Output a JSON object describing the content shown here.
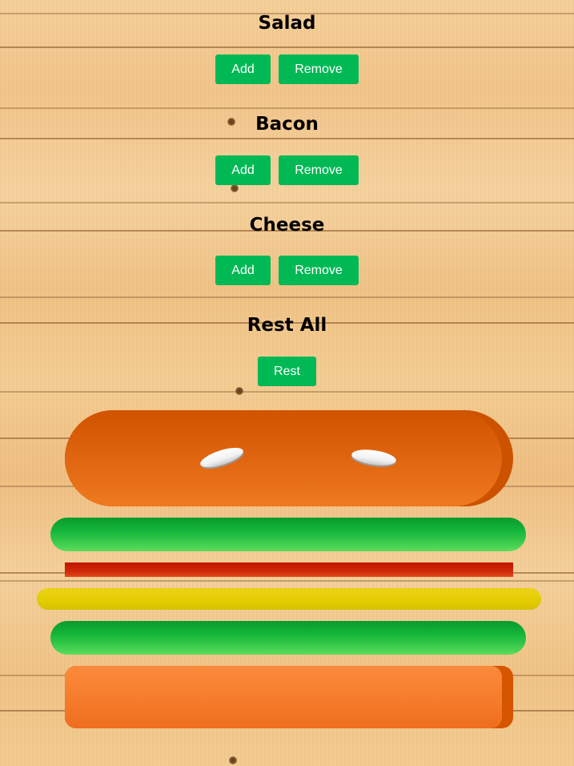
{
  "controls": [
    {
      "title": "Salad",
      "add_label": "Add",
      "remove_label": "Remove"
    },
    {
      "title": "Bacon",
      "add_label": "Add",
      "remove_label": "Remove"
    },
    {
      "title": "Cheese",
      "add_label": "Add",
      "remove_label": "Remove"
    }
  ],
  "reset": {
    "title": "Rest All",
    "button_label": "Rest"
  },
  "burger": {
    "layers": [
      "bun-top",
      "salad",
      "bacon",
      "cheese",
      "salad",
      "bun-bottom"
    ]
  },
  "colors": {
    "button": "#00b955",
    "button_text": "#ffffff",
    "bun": "#e06511",
    "salad": "#14b63a",
    "bacon": "#c21400",
    "cheese": "#e3cc00"
  }
}
